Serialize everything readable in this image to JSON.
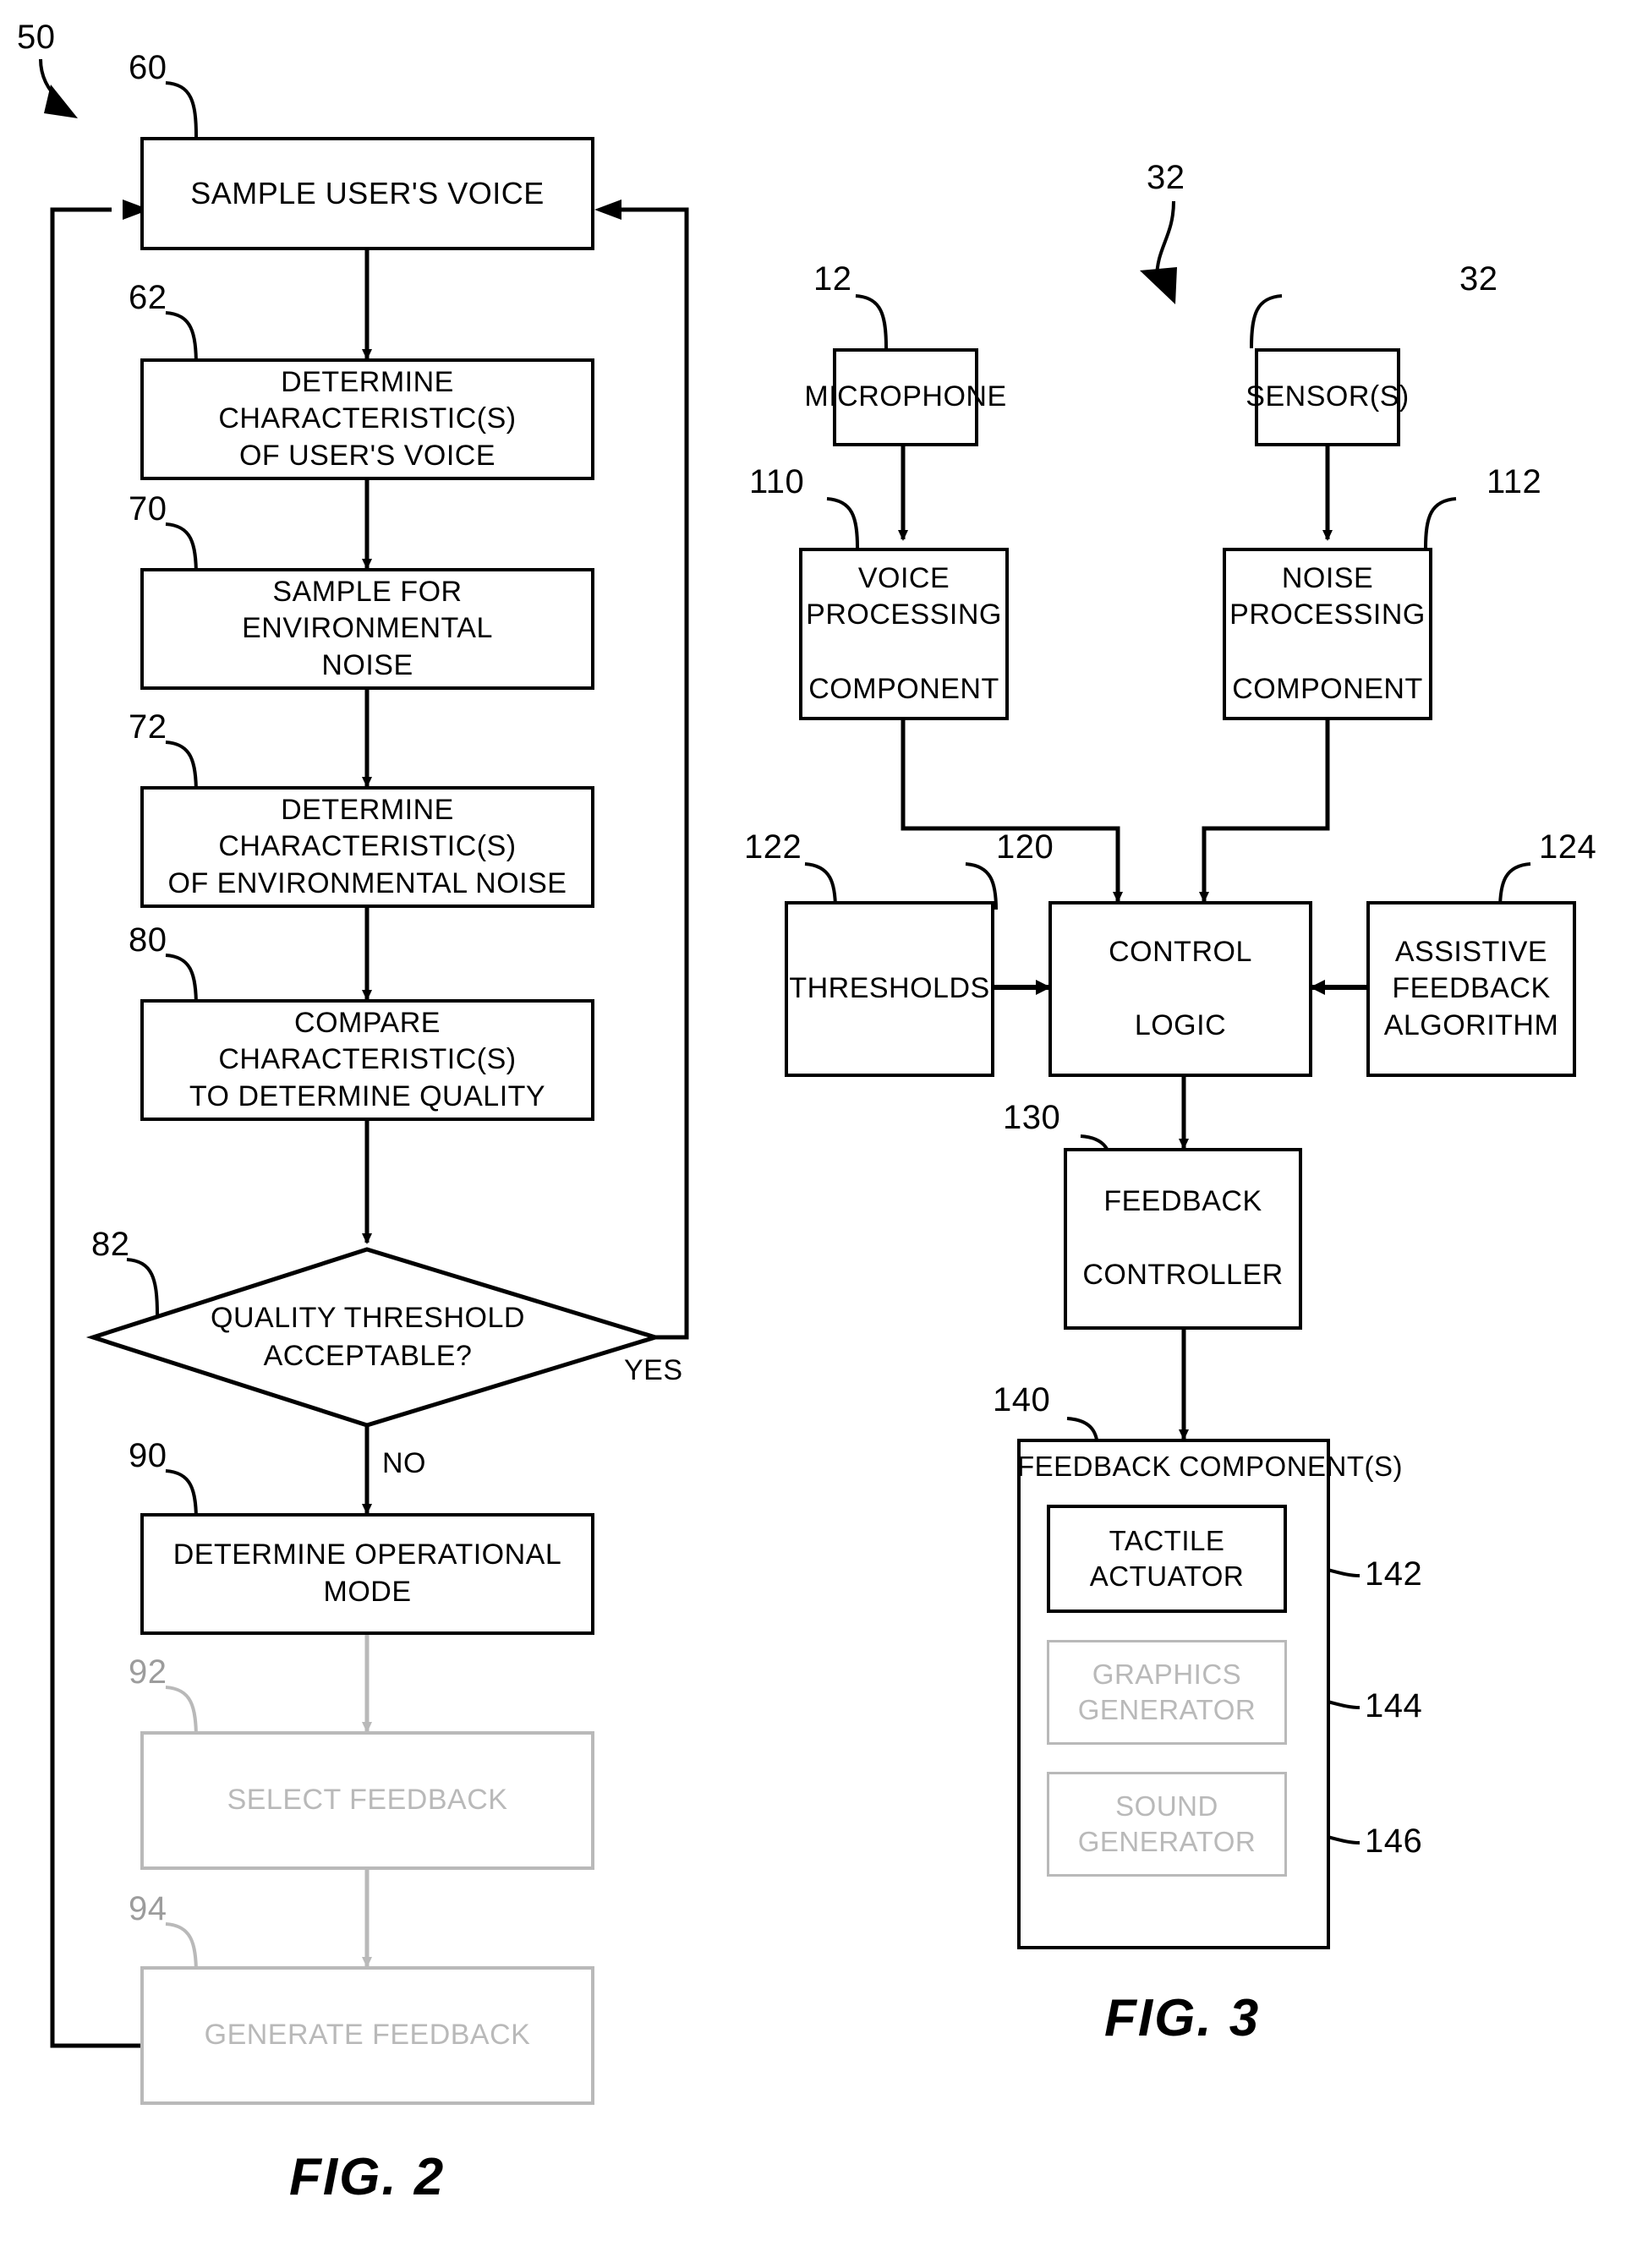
{
  "figures": [
    {
      "id": "fig2",
      "caption": "FIG. 2",
      "overall_ref": "50",
      "nodes": [
        {
          "ref": "60",
          "label": "SAMPLE USER'S VOICE",
          "shape": "rect",
          "faint": false
        },
        {
          "ref": "62",
          "label": "DETERMINE CHARACTERISTIC(S) OF USER'S VOICE",
          "shape": "rect",
          "faint": false
        },
        {
          "ref": "70",
          "label": "SAMPLE FOR ENVIRONMENTAL NOISE",
          "shape": "rect",
          "faint": false
        },
        {
          "ref": "72",
          "label": "DETERMINE CHARACTERISTIC(S) OF ENVIRONMENTAL NOISE",
          "shape": "rect",
          "faint": false
        },
        {
          "ref": "80",
          "label": "COMPARE CHARACTERISTIC(S) TO DETERMINE QUALITY",
          "shape": "rect",
          "faint": false
        },
        {
          "ref": "82",
          "label": "QUALITY THRESHOLD ACCEPTABLE?",
          "shape": "diamond",
          "faint": false
        },
        {
          "ref": "90",
          "label": "DETERMINE OPERATIONAL MODE",
          "shape": "rect",
          "faint": false
        },
        {
          "ref": "92",
          "label": "SELECT FEEDBACK",
          "shape": "rect",
          "faint": true
        },
        {
          "ref": "94",
          "label": "GENERATE FEEDBACK",
          "shape": "rect",
          "faint": true
        }
      ],
      "edge_labels": {
        "yes": "YES",
        "no": "NO"
      }
    },
    {
      "id": "fig3",
      "caption": "FIG. 3",
      "overall_ref": "32",
      "nodes": [
        {
          "ref": "12",
          "label": "MICROPHONE",
          "faint": false
        },
        {
          "ref": "32",
          "label": "SENSOR(S)",
          "faint": false
        },
        {
          "ref": "110",
          "label": "VOICE PROCESSING COMPONENT",
          "faint": false
        },
        {
          "ref": "112",
          "label": "NOISE PROCESSING COMPONENT",
          "faint": false
        },
        {
          "ref": "122",
          "label": "THRESHOLDS",
          "faint": false
        },
        {
          "ref": "120",
          "label": "CONTROL LOGIC",
          "faint": false
        },
        {
          "ref": "124",
          "label": "ASSISTIVE FEEDBACK ALGORITHM",
          "faint": false
        },
        {
          "ref": "130",
          "label": "FEEDBACK CONTROLLER",
          "faint": false
        },
        {
          "ref": "140",
          "label": "FEEDBACK COMPONENT(S)",
          "faint": false
        },
        {
          "ref": "142",
          "label": "TACTILE ACTUATOR",
          "faint": false
        },
        {
          "ref": "144",
          "label": "GRAPHICS GENERATOR",
          "faint": true
        },
        {
          "ref": "146",
          "label": "SOUND GENERATOR",
          "faint": true
        }
      ]
    }
  ],
  "fig2": {
    "caption": "FIG. 2",
    "ref_50": "50",
    "ref_60": "60",
    "ref_62": "62",
    "ref_70": "70",
    "ref_72": "72",
    "ref_80": "80",
    "ref_82": "82",
    "ref_90": "90",
    "ref_92": "92",
    "ref_94": "94",
    "box_60": "SAMPLE USER'S VOICE",
    "box_62_line1": "DETERMINE CHARACTERISTIC(S)",
    "box_62_line2": "OF USER'S VOICE",
    "box_70_line1": "SAMPLE FOR ENVIRONMENTAL",
    "box_70_line2": "NOISE",
    "box_72_line1": "DETERMINE CHARACTERISTIC(S)",
    "box_72_line2": "OF ENVIRONMENTAL NOISE",
    "box_80_line1": "COMPARE CHARACTERISTIC(S)",
    "box_80_line2": "TO DETERMINE QUALITY",
    "diamond_82_line1": "QUALITY THRESHOLD",
    "diamond_82_line2": "ACCEPTABLE?",
    "box_90": "DETERMINE OPERATIONAL MODE",
    "box_92": "SELECT FEEDBACK",
    "box_94": "GENERATE FEEDBACK",
    "label_yes": "YES",
    "label_no": "NO"
  },
  "fig3": {
    "caption": "FIG. 3",
    "ref_32_top": "32",
    "ref_12": "12",
    "ref_32_sensor": "32",
    "ref_110": "110",
    "ref_112": "112",
    "ref_122": "122",
    "ref_120": "120",
    "ref_124": "124",
    "ref_130": "130",
    "ref_140": "140",
    "ref_142": "142",
    "ref_144": "144",
    "ref_146": "146",
    "box_12": "MICROPHONE",
    "box_32": "SENSOR(S)",
    "box_110_line1": "VOICE PROCESSING",
    "box_110_line2": "COMPONENT",
    "box_112_line1": "NOISE PROCESSING",
    "box_112_line2": "COMPONENT",
    "box_122": "THRESHOLDS",
    "box_120_line1": "CONTROL",
    "box_120_line2": "LOGIC",
    "box_124_line1": "ASSISTIVE",
    "box_124_line2": "FEEDBACK",
    "box_124_line3": "ALGORITHM",
    "box_130_line1": "FEEDBACK",
    "box_130_line2": "CONTROLLER",
    "box_140_title": "FEEDBACK COMPONENT(S)",
    "box_142_line1": "TACTILE",
    "box_142_line2": "ACTUATOR",
    "box_144_line1": "GRAPHICS",
    "box_144_line2": "GENERATOR",
    "box_146_line1": "SOUND",
    "box_146_line2": "GENERATOR"
  },
  "colors": {
    "ink": "#000000",
    "faint_ink": "#b9b9b9",
    "paper": "#ffffff"
  }
}
